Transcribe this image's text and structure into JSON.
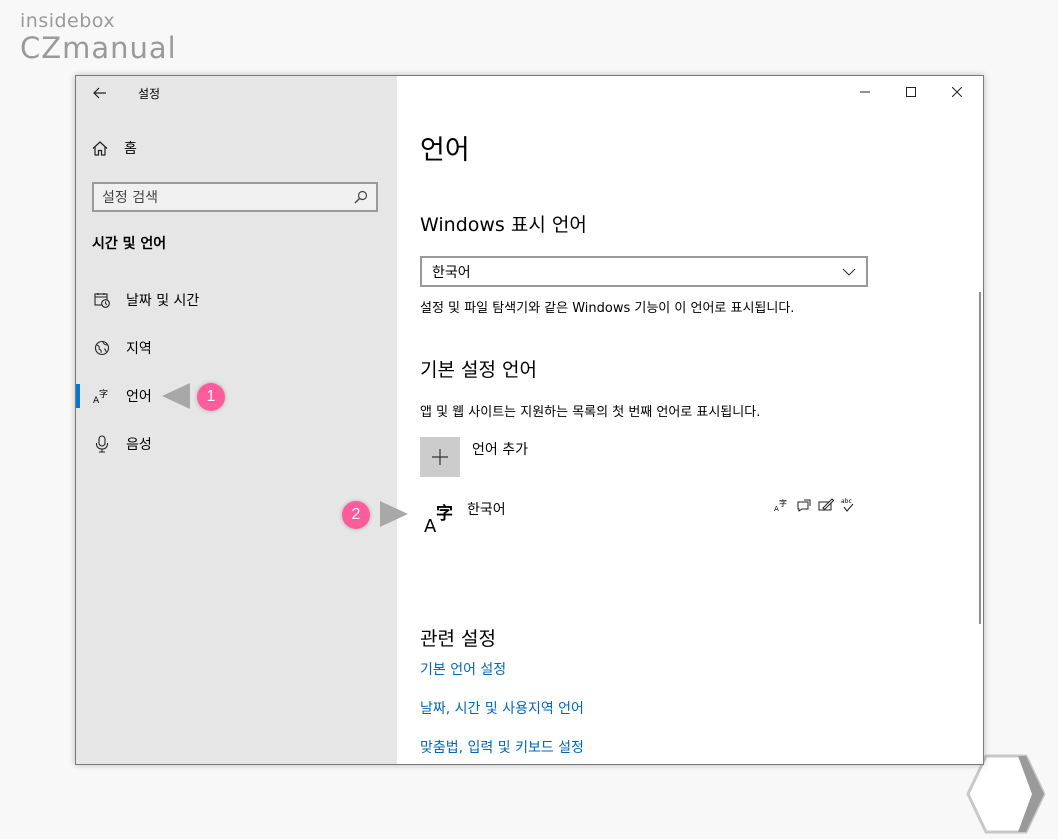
{
  "watermark": {
    "line1": "insidebox",
    "line2": "CZmanual"
  },
  "window": {
    "title": "설정",
    "back_icon": "arrow-left-icon",
    "controls": [
      "minimize-icon",
      "maximize-icon",
      "close-icon"
    ]
  },
  "sidebar": {
    "home_label": "홈",
    "search_placeholder": "설정 검색",
    "section_title": "시간 및 언어",
    "items": [
      {
        "label": "날짜 및 시간",
        "icon": "calendar-clock-icon"
      },
      {
        "label": "지역",
        "icon": "globe-icon"
      },
      {
        "label": "언어",
        "icon": "language-icon",
        "active": true
      },
      {
        "label": "음성",
        "icon": "microphone-icon"
      }
    ]
  },
  "annotations": {
    "badge1": "1",
    "badge2": "2"
  },
  "main": {
    "page_title": "언어",
    "display_language": {
      "heading": "Windows 표시 언어",
      "selected": "한국어",
      "description": "설정 및 파일 탐색기와 같은 Windows 기능이 이 언어로 표시됩니다."
    },
    "preferred_language": {
      "heading": "기본 설정 언어",
      "description": "앱 및 웹 사이트는 지원하는 목록의 첫 번째 언어로 표시됩니다.",
      "add_label": "언어 추가",
      "languages": [
        {
          "name": "한국어",
          "feature_icons": [
            "display-language-icon",
            "speech-icon",
            "handwriting-icon",
            "spellcheck-icon"
          ]
        }
      ]
    },
    "related": {
      "heading": "관련 설정",
      "links": [
        "기본 언어 설정",
        "날짜, 시간 및 사용지역 언어",
        "맞춤법, 입력 및 키보드 설정"
      ]
    }
  },
  "colors": {
    "accent": "#0078d7",
    "link": "#0067b8",
    "sidebar_bg": "#e6e6e6",
    "badge": "#ff5c9b"
  }
}
